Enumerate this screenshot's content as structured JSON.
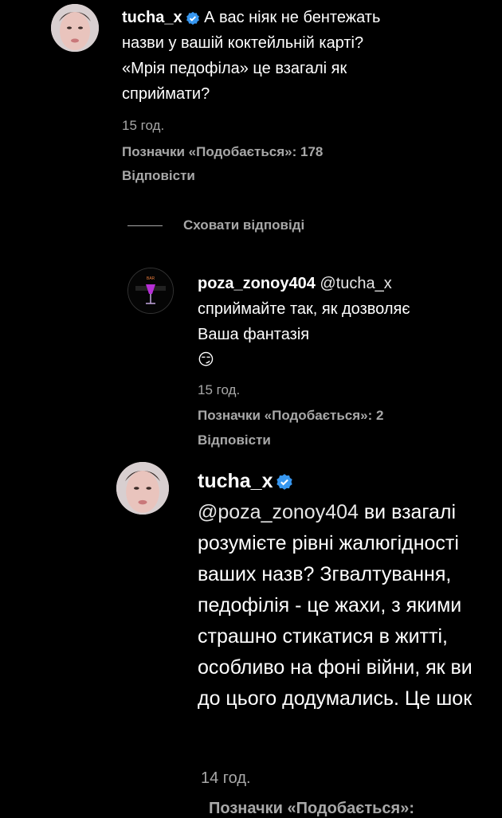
{
  "comments": [
    {
      "username": "tucha_x",
      "verified": true,
      "text": "А вас ніяк не бентежать назви у вашій коктейльній карті? «Мрія педофіла» це взагалі як сприймати?",
      "time": "15 год.",
      "likes": "Позначки «Подобається»: 178",
      "reply": "Відповісти"
    },
    {
      "username": "poza_zonoy404",
      "mention": "@tucha_x",
      "text": "сприймайте так, як дозволяє Ваша фантазія",
      "emoji": "😏",
      "time": "15 год.",
      "likes": "Позначки «Подобається»: 2",
      "reply": "Відповісти"
    },
    {
      "username": "tucha_x",
      "verified": true,
      "mention": "@poza_zonoy404",
      "text": "ви взагалі розумієте рівні жалюгідності ваших назв? Згвалтування, педофілія - це жахи, з якими страшно стикатися в житті, особливо на фоні війни, як ви до цього додумались. Це шок",
      "time": "14 год.",
      "likes": "Позначки «Подобається»:"
    }
  ],
  "hide_replies": "Сховати відповіді",
  "colors": {
    "verified": "#3797f0",
    "muted": "#a8a8a8",
    "background": "#000000"
  },
  "icons": {
    "verified": "verified-badge-icon"
  }
}
